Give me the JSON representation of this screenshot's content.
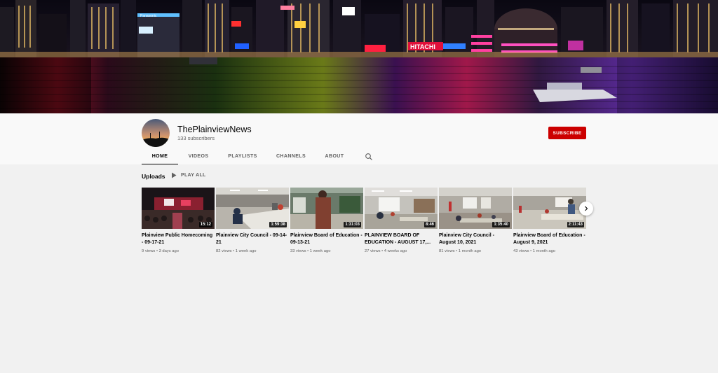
{
  "channel": {
    "name": "ThePlainviewNews",
    "subscribers": "133 subscribers",
    "subscribe_label": "SUBSCRIBE"
  },
  "banner": {
    "signs": [
      "Panasonic",
      "HITACHI"
    ]
  },
  "tabs": [
    {
      "label": "HOME",
      "active": true
    },
    {
      "label": "VIDEOS",
      "active": false
    },
    {
      "label": "PLAYLISTS",
      "active": false
    },
    {
      "label": "CHANNELS",
      "active": false
    },
    {
      "label": "ABOUT",
      "active": false
    }
  ],
  "uploads": {
    "title": "Uploads",
    "play_all_label": "PLAY ALL",
    "videos": [
      {
        "title": "Plainview Public Homecoming - 09-17-21",
        "duration": "15:12",
        "meta": "9 views • 3 days ago"
      },
      {
        "title": "Plainview City Council - 09-14-21",
        "duration": "1:59:38",
        "meta": "82 views • 1 week ago"
      },
      {
        "title": "Plainview Board of Education - 09-13-21",
        "duration": "1:31:03",
        "meta": "33 views • 1 week ago"
      },
      {
        "title": "PLAINVIEW BOARD OF EDUCATION - AUGUST 17,...",
        "duration": "8:46",
        "meta": "27 views • 4 weeks ago"
      },
      {
        "title": "Plainview City Council - August 10, 2021",
        "duration": "1:35:40",
        "meta": "81 views • 1 month ago"
      },
      {
        "title": "Plainview Board of Education - August 9, 2021",
        "duration": "2:11:43",
        "meta": "43 views • 1 month ago"
      }
    ]
  },
  "icons": {
    "search": "search-icon",
    "play": "play-icon",
    "next": "chevron-right-icon"
  },
  "colors": {
    "subscribe": "#cc0000",
    "background": "#f1f1f1",
    "header": "#f9f9f9"
  }
}
